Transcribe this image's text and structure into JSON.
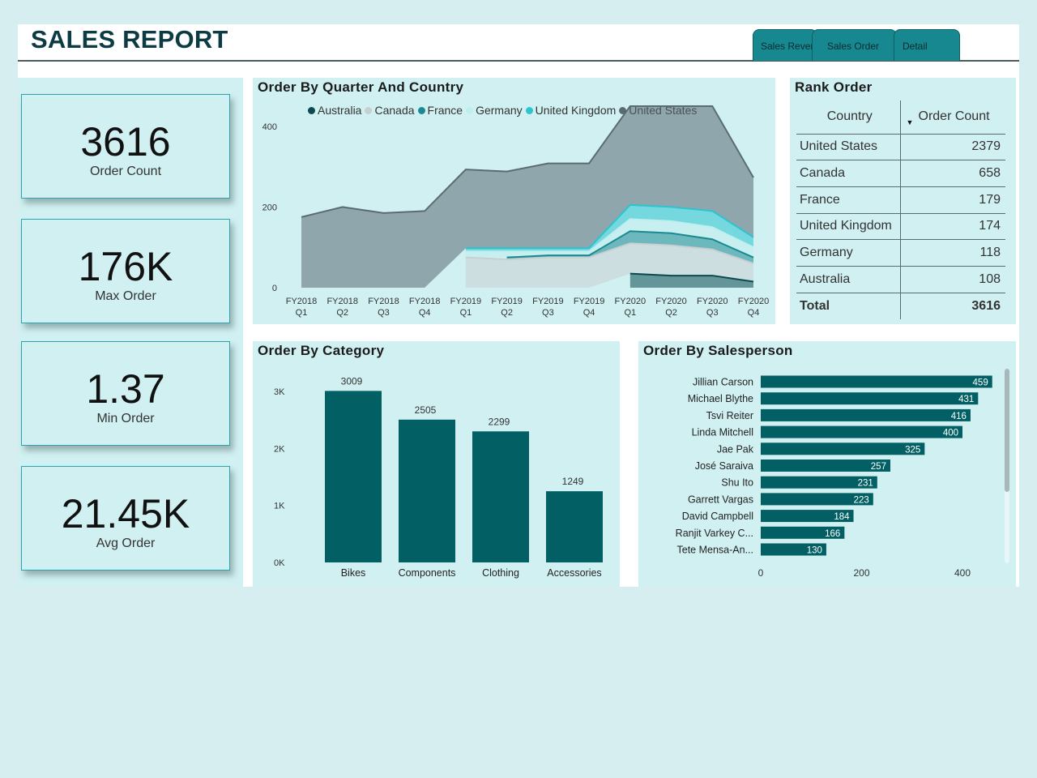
{
  "header": {
    "title": "SALES REPORT",
    "tabs": [
      {
        "label": "Sales Revenue"
      },
      {
        "label": "Sales Order"
      },
      {
        "label": "Detail"
      }
    ]
  },
  "kpis": [
    {
      "value": "3616",
      "label": "Order Count"
    },
    {
      "value": "176K",
      "label": "Max Order"
    },
    {
      "value": "1.37",
      "label": "Min Order"
    },
    {
      "value": "21.45K",
      "label": "Avg Order"
    }
  ],
  "colors": {
    "australia": "#0b4a4f",
    "canada": "#c8cfd2",
    "france": "#1a8a90",
    "germany": "#bfeeee",
    "united_kingdom": "#2cc4cf",
    "united_states": "#5a6c72",
    "bar": "#025f63",
    "panel": "#d0f0f2"
  },
  "area_chart": {
    "title": "Order By Quarter And Country",
    "chart_data": {
      "type": "area",
      "stacked": true,
      "x": [
        "FY2018 Q1",
        "FY2018 Q2",
        "FY2018 Q3",
        "FY2018 Q4",
        "FY2019 Q1",
        "FY2019 Q2",
        "FY2019 Q3",
        "FY2019 Q4",
        "FY2020 Q1",
        "FY2020 Q2",
        "FY2020 Q3",
        "FY2020 Q4"
      ],
      "x_tick_top": [
        "FY2018",
        "FY2018",
        "FY2018",
        "FY2018",
        "FY2019",
        "FY2019",
        "FY2019",
        "FY2019",
        "FY2020",
        "FY2020",
        "FY2020",
        "FY2020"
      ],
      "x_tick_bottom": [
        "Q1",
        "Q2",
        "Q3",
        "Q4",
        "Q1",
        "Q2",
        "Q3",
        "Q4",
        "Q1",
        "Q2",
        "Q3",
        "Q4"
      ],
      "yticks": [
        0,
        200,
        400
      ],
      "ylim": [
        0,
        480
      ],
      "grid": false,
      "legend_position": "top",
      "series": [
        {
          "name": "Australia",
          "color_key": "australia",
          "values": [
            0,
            0,
            0,
            0,
            0,
            0,
            0,
            0,
            35,
            30,
            30,
            15
          ]
        },
        {
          "name": "Canada",
          "color_key": "canada",
          "values": [
            0,
            0,
            0,
            0,
            75,
            70,
            75,
            75,
            75,
            75,
            65,
            45
          ]
        },
        {
          "name": "France",
          "color_key": "france",
          "values": [
            0,
            0,
            0,
            0,
            0,
            5,
            5,
            5,
            30,
            30,
            25,
            15
          ]
        },
        {
          "name": "Germany",
          "color_key": "germany",
          "values": [
            0,
            0,
            0,
            0,
            15,
            15,
            10,
            10,
            30,
            30,
            30,
            25
          ]
        },
        {
          "name": "United Kingdom",
          "color_key": "united_kingdom",
          "values": [
            0,
            0,
            0,
            0,
            8,
            8,
            8,
            8,
            35,
            35,
            40,
            25
          ]
        },
        {
          "name": "United States",
          "color_key": "united_states",
          "values": [
            175,
            200,
            185,
            190,
            195,
            190,
            210,
            210,
            245,
            250,
            260,
            148
          ]
        }
      ]
    }
  },
  "rank_table": {
    "title": "Rank Order",
    "columns": [
      "Country",
      "Order Count"
    ],
    "rows": [
      {
        "country": "United States",
        "count": "2379"
      },
      {
        "country": "Canada",
        "count": "658"
      },
      {
        "country": "France",
        "count": "179"
      },
      {
        "country": "United Kingdom",
        "count": "174"
      },
      {
        "country": "Germany",
        "count": "118"
      },
      {
        "country": "Australia",
        "count": "108"
      }
    ],
    "total_label": "Total",
    "total_value": "3616"
  },
  "category_chart": {
    "title": "Order By Category",
    "chart_data": {
      "type": "bar",
      "categories": [
        "Bikes",
        "Components",
        "Clothing",
        "Accessories"
      ],
      "values": [
        3009,
        2505,
        2299,
        1249
      ],
      "data_labels": [
        "3009",
        "2505",
        "2299",
        "1249"
      ],
      "yticks": [
        0,
        1000,
        2000,
        3000
      ],
      "ytick_labels": [
        "0K",
        "1K",
        "2K",
        "3K"
      ],
      "ylim": [
        0,
        3200
      ],
      "grid": false
    }
  },
  "salesperson_chart": {
    "title": "Order By Salesperson",
    "chart_data": {
      "type": "bar",
      "orientation": "horizontal",
      "categories": [
        "Jillian Carson",
        "Michael Blythe",
        "Tsvi Reiter",
        "Linda Mitchell",
        "Jae Pak",
        "José Saraiva",
        "Shu Ito",
        "Garrett Vargas",
        "David Campbell",
        "Ranjit Varkey C...",
        "Tete Mensa-An..."
      ],
      "values": [
        459,
        431,
        416,
        400,
        325,
        257,
        231,
        223,
        184,
        166,
        130
      ],
      "xticks": [
        0,
        200,
        400
      ],
      "xlim": [
        0,
        525
      ],
      "grid": false
    }
  }
}
